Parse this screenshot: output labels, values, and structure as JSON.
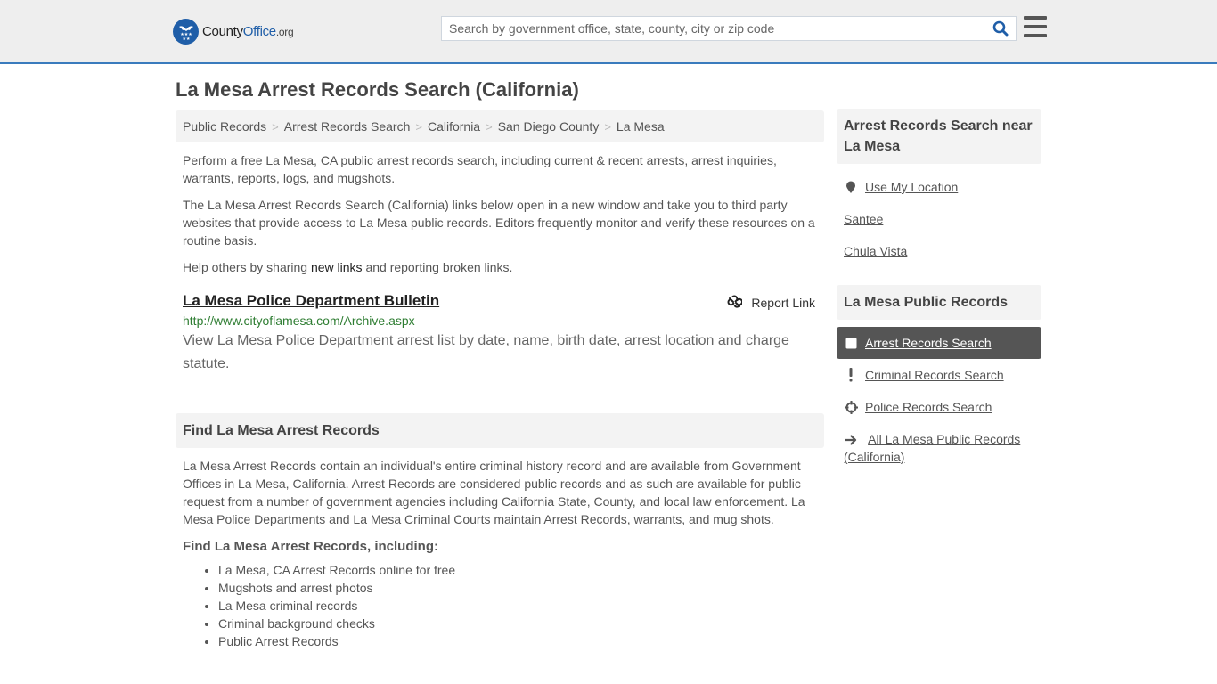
{
  "header": {
    "logo": {
      "part1": "County",
      "part2": "Office",
      "part3": ".org"
    },
    "search": {
      "placeholder": "Search by government office, state, county, city or zip code",
      "value": ""
    },
    "accent_color": "#3a7bbd",
    "brand_color": "#1f5ea8"
  },
  "page": {
    "title": "La Mesa Arrest Records Search (California)"
  },
  "breadcrumb": [
    "Public Records",
    "Arrest Records Search",
    "California",
    "San Diego County",
    "La Mesa"
  ],
  "intro": {
    "p1": "Perform a free La Mesa, CA public arrest records search, including current & recent arrests, arrest inquiries, warrants, reports, logs, and mugshots.",
    "p2": "The La Mesa Arrest Records Search (California) links below open in a new window and take you to third party websites that provide access to La Mesa public records. Editors frequently monitor and verify these resources on a routine basis.",
    "p3_before": "Help others by sharing ",
    "p3_link": "new links",
    "p3_after": " and reporting broken links."
  },
  "results": [
    {
      "title": "La Mesa Police Department Bulletin",
      "url": "http://www.cityoflamesa.com/Archive.aspx",
      "description": "View La Mesa Police Department arrest list by date, name, birth date, arrest location and charge statute.",
      "report_label": "Report Link"
    }
  ],
  "find_section": {
    "heading": "Find La Mesa Arrest Records",
    "body": "La Mesa Arrest Records contain an individual's entire criminal history record and are available from Government Offices in La Mesa, California. Arrest Records are considered public records and as such are available for public request from a number of government agencies including California State, County, and local law enforcement. La Mesa Police Departments and La Mesa Criminal Courts maintain Arrest Records, warrants, and mug shots.",
    "subheading": "Find La Mesa Arrest Records, including:",
    "items": [
      "La Mesa, CA Arrest Records online for free",
      "Mugshots and arrest photos",
      "La Mesa criminal records",
      "Criminal background checks",
      "Public Arrest Records"
    ]
  },
  "sidebar": {
    "nearby": {
      "heading": "Arrest Records Search near La Mesa",
      "use_location": "Use My Location",
      "places": [
        "Santee",
        "Chula Vista"
      ]
    },
    "public_records": {
      "heading": "La Mesa Public Records",
      "items": [
        {
          "label": "Arrest Records Search",
          "icon": "square-icon",
          "active": true
        },
        {
          "label": "Criminal Records Search",
          "icon": "exclamation-icon",
          "active": false
        },
        {
          "label": "Police Records Search",
          "icon": "crosshair-icon",
          "active": false
        },
        {
          "label": "All La Mesa Public Records (California)",
          "icon": "arrow-right-icon",
          "active": false
        }
      ]
    }
  }
}
